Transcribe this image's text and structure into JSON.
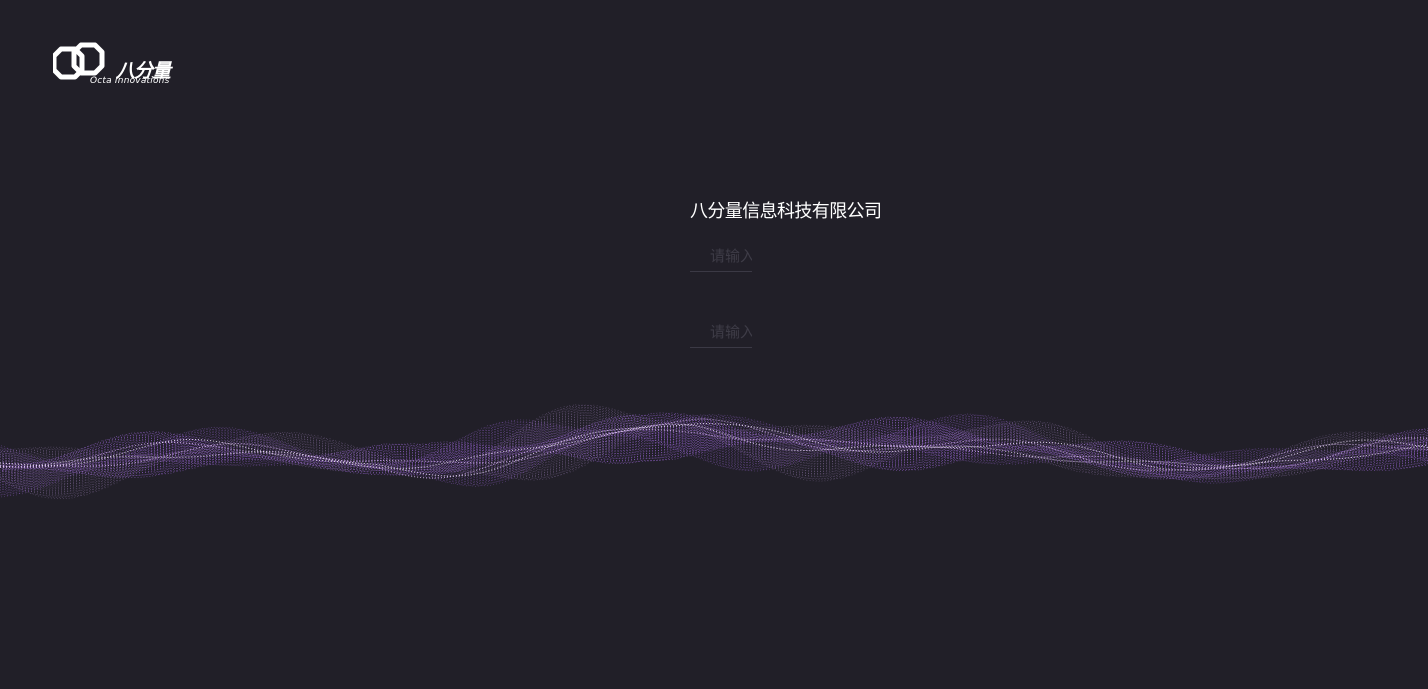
{
  "brand": {
    "logo_icon": "octa-link-logo",
    "name_cn": "八分量",
    "name_en": "Octa Innovations"
  },
  "login": {
    "company_name": "八分量信息科技有限公司",
    "username_placeholder": "请输入",
    "password_placeholder": "请输入"
  },
  "decoration": {
    "wave": "purple-particle-wave",
    "accent_color": "#b98be0",
    "background_color": "#211f28"
  }
}
